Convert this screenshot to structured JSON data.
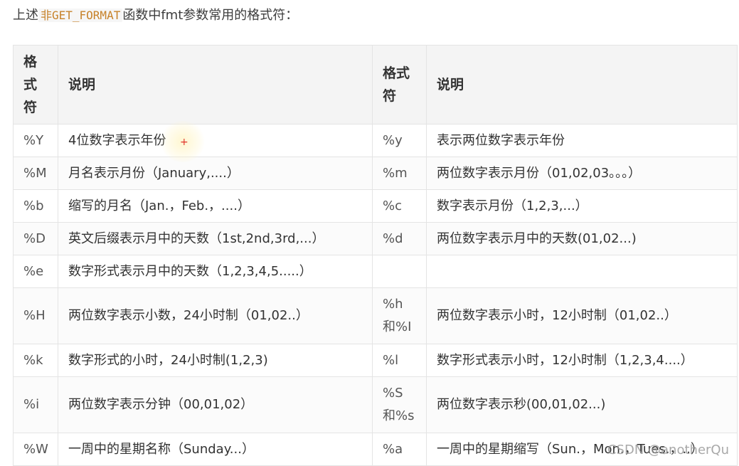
{
  "intro": {
    "prefix": "上述",
    "code": "非GET_FORMAT",
    "suffix": "函数中fmt参数常用的格式符："
  },
  "table": {
    "headers": [
      "格式符",
      "说明",
      "格式符",
      "说明"
    ],
    "rows": [
      [
        "%Y",
        "4位数字表示年份",
        "%y",
        "表示两位数字表示年份"
      ],
      [
        "%M",
        "月名表示月份（January,....）",
        "%m",
        "两位数字表示月份（01,02,03。。。）"
      ],
      [
        "%b",
        "缩写的月名（Jan.，Feb.，....）",
        "%c",
        "数字表示月份（1,2,3,...）"
      ],
      [
        "%D",
        "英文后缀表示月中的天数（1st,2nd,3rd,...）",
        "%d",
        "两位数字表示月中的天数(01,02...)"
      ],
      [
        "%e",
        "数字形式表示月中的天数（1,2,3,4,5.....）",
        "",
        ""
      ],
      [
        "%H",
        "两位数字表示小数，24小时制（01,02..）",
        "%h和%I",
        "两位数字表示小时，12小时制（01,02..）"
      ],
      [
        "%k",
        "数字形式的小时，24小时制(1,2,3)",
        "%l",
        "数字形式表示小时，12小时制（1,2,3,4....）"
      ],
      [
        "%i",
        "两位数字表示分钟（00,01,02）",
        "%S和%s",
        "两位数字表示秒(00,01,02...)"
      ],
      [
        "%W",
        "一周中的星期名称（Sunday...）",
        "%a",
        "一周中的星期缩写（Sun.，Mon.，Tues.，..）"
      ]
    ]
  },
  "cursor_glyph": "+",
  "watermark": "CSDN @anotherQu"
}
